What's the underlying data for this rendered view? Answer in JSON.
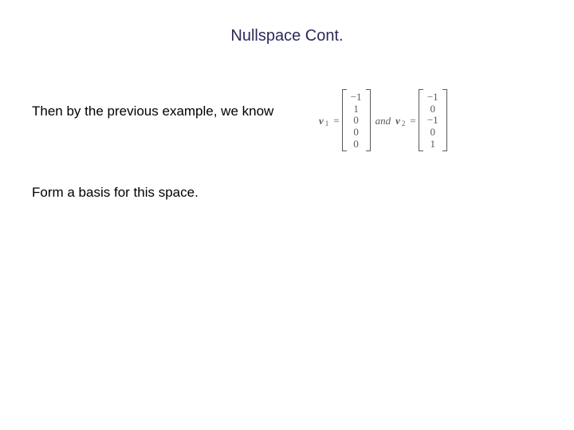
{
  "title": "Nullspace Cont.",
  "line1": "Then by the previous example, we know",
  "line2": "Form a basis for this space.",
  "math": {
    "v1_label": "v",
    "v1_sub": "1",
    "eq": "=",
    "and": "and",
    "v2_label": "v",
    "v2_sub": "2",
    "vec1": {
      "r0": "−1",
      "r1": "1",
      "r2": "0",
      "r3": "0",
      "r4": "0"
    },
    "vec2": {
      "r0": "−1",
      "r1": "0",
      "r2": "−1",
      "r3": "0",
      "r4": "1"
    }
  }
}
